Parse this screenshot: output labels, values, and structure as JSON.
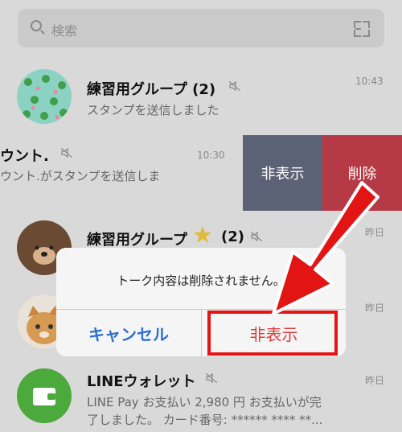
{
  "search": {
    "placeholder": "検索"
  },
  "chats": [
    {
      "name": "練習用グループ (2)",
      "preview": "スタンプを送信しました",
      "time": "10:43"
    },
    {
      "name": "ウント.",
      "preview": "ウント.がスタンプを送信しま",
      "time": "10:30"
    },
    {
      "name": "練習用グループ",
      "count": "(2)",
      "preview": "",
      "time": "昨日"
    },
    {
      "name": "",
      "preview": "",
      "time": "昨日"
    },
    {
      "name": "LINEウォレット",
      "preview_line1": "LINE Pay お支払い 2,980 円 お支払いが完",
      "preview_line2": "了しました。 カード番号: ****** **** **...",
      "time": "昨日"
    }
  ],
  "swipe_actions": {
    "hide": "非表示",
    "delete": "削除"
  },
  "dialog": {
    "message": "トーク内容は削除されません。",
    "cancel": "キャンセル",
    "hide": "非表示"
  },
  "colors": {
    "hide_bg": "#5c6275",
    "delete_bg": "#b53a45",
    "cancel_text": "#2f6fd3",
    "hide_text": "#e23b3b",
    "annotation": "#e31414"
  }
}
